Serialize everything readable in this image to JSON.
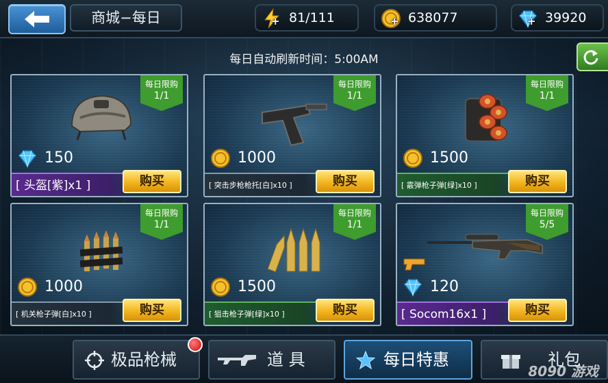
{
  "header": {
    "back_icon": "arrow-left-icon",
    "title": "商城−每日",
    "energy": "81/111",
    "gold": "638077",
    "diamonds": "39920",
    "plus": "+"
  },
  "refresh_note": "每日自动刷新时间：5:00AM",
  "refresh_button_icon": "refresh-icon",
  "cards": [
    {
      "limit_label": "每日限购",
      "limit": "1/1",
      "item_icon": "helmet-icon",
      "currency_icon": "diamond-icon",
      "price": "150",
      "name": "[ 头盔[紫]x1 ]",
      "rarity": "purple",
      "buy": "购买"
    },
    {
      "limit_label": "每日限购",
      "limit": "1/1",
      "item_icon": "rifle-stock-icon",
      "currency_icon": "gold-coin-icon",
      "price": "1000",
      "name": "[ 突击步枪枪托[白]x10 ]",
      "rarity": "white",
      "buy": "购买"
    },
    {
      "limit_label": "每日限购",
      "limit": "1/1",
      "item_icon": "shotgun-shells-icon",
      "currency_icon": "gold-coin-icon",
      "price": "1500",
      "name": "[ 霰弹枪子弹[绿]x10 ]",
      "rarity": "green",
      "buy": "购买"
    },
    {
      "limit_label": "每日限购",
      "limit": "1/1",
      "item_icon": "machine-gun-ammo-icon",
      "currency_icon": "gold-coin-icon",
      "price": "1000",
      "name": "[ 机关枪子弹[白]x10 ]",
      "rarity": "white",
      "buy": "购买"
    },
    {
      "limit_label": "每日限购",
      "limit": "1/1",
      "item_icon": "sniper-ammo-icon",
      "currency_icon": "gold-coin-icon",
      "price": "1500",
      "name": "[ 狙击枪子弹[绿]x10 ]",
      "rarity": "green",
      "buy": "购买"
    },
    {
      "limit_label": "每日限购",
      "limit": "5/5",
      "item_icon": "sniper-rifle-icon",
      "currency_icon": "diamond-icon",
      "price": "120",
      "name": "[ Socom16x1 ]",
      "rarity": "purple",
      "buy": "购买"
    }
  ],
  "tabs": [
    {
      "label": "极品枪械",
      "icon": "crosshair-icon",
      "has_notification": true
    },
    {
      "label": "道 具",
      "icon": "rifle-icon"
    },
    {
      "label": "每日特惠",
      "icon": "star-icon",
      "active": true
    },
    {
      "label": "礼包",
      "icon": "gift-icon"
    }
  ],
  "watermark": "8090 游戏"
}
